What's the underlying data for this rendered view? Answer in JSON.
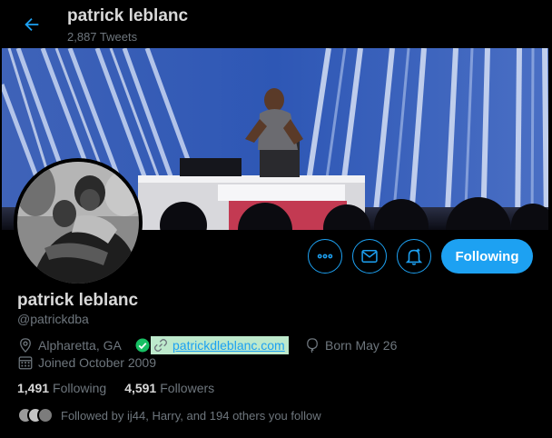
{
  "header": {
    "name": "patrick leblanc",
    "tweet_count": "2,887 Tweets"
  },
  "profile": {
    "name": "patrick leblanc",
    "handle": "@patrickdba",
    "location": "Alpharetta, GA",
    "website": "patrickdleblanc.com",
    "birthday": "Born May 26",
    "joined": "Joined October 2009"
  },
  "stats": {
    "following_count": "1,491",
    "following_label": "Following",
    "followers_count": "4,591",
    "followers_label": "Followers"
  },
  "followed_by": "Followed by ij44, Harry, and 194 others you follow",
  "actions": {
    "follow_state_label": "Following"
  },
  "icons": {
    "back": "back-arrow-icon",
    "more": "more-icon",
    "message": "mail-icon",
    "notify": "bell-icon",
    "location": "location-pin-icon",
    "verified": "check-badge-icon",
    "link": "link-icon",
    "birthday": "balloon-icon",
    "joined": "calendar-icon"
  },
  "colors": {
    "accent": "#1da1f2",
    "background": "#000000",
    "secondary_text": "#6e767d",
    "link_highlight": "#bde9cc",
    "verified_badge": "#17bf63"
  }
}
